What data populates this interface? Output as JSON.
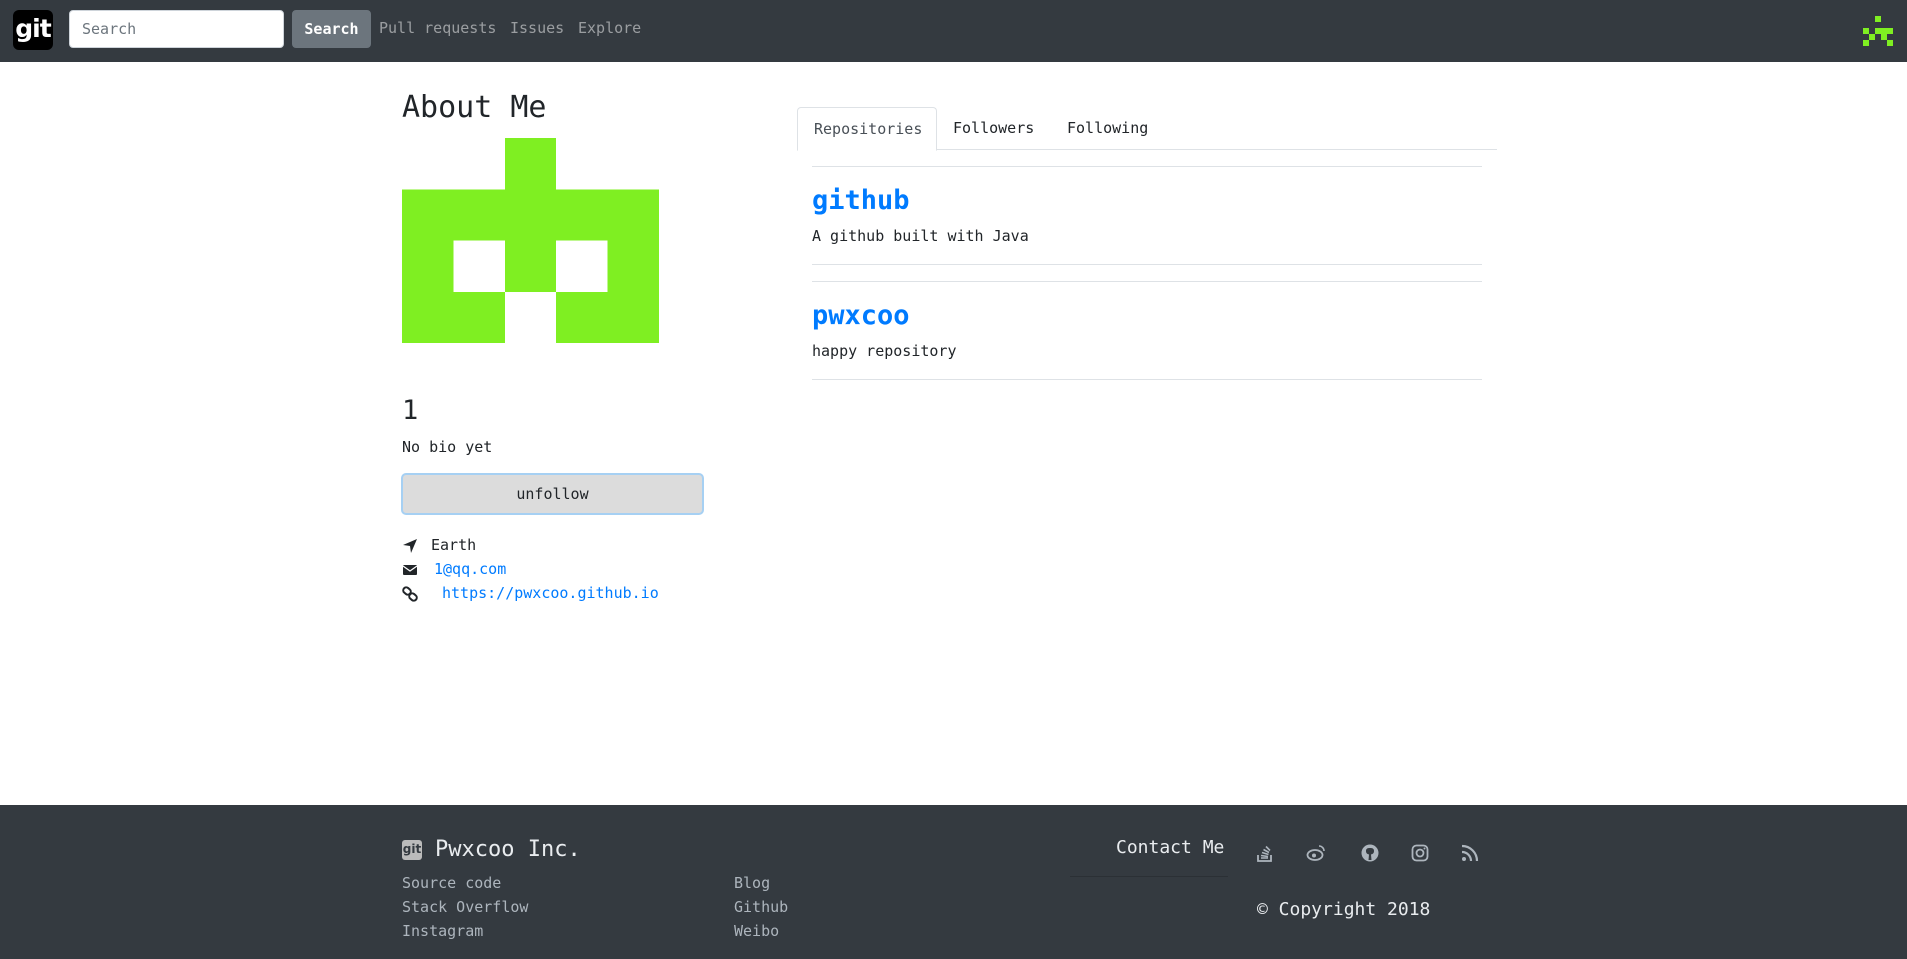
{
  "navbar": {
    "logo_text": "git",
    "search_placeholder": "Search",
    "search_button": "Search",
    "links": [
      "Pull requests",
      "Issues",
      "Explore"
    ]
  },
  "sidebar": {
    "title": "About Me",
    "avatar_color": "#7fef22",
    "username": "1",
    "bio": "No bio yet",
    "unfollow_label": "unfollow",
    "location": "Earth",
    "email": "1@qq.com",
    "website": "https://pwxcoo.github.io"
  },
  "tabs": [
    "Repositories",
    "Followers",
    "Following"
  ],
  "repositories": [
    {
      "name": "github",
      "description": "A github built with Java"
    },
    {
      "name": "pwxcoo",
      "description": "happy repository"
    }
  ],
  "footer": {
    "logo_text": "git",
    "company": "Pwxcoo Inc.",
    "links_col1": [
      "Source code",
      "Stack Overflow",
      "Instagram"
    ],
    "links_col2": [
      "Blog",
      "Github",
      "Weibo"
    ],
    "contact_title": "Contact Me",
    "social_icons": [
      "stackoverflow-icon",
      "weibo-icon",
      "github-icon",
      "instagram-icon",
      "rss-icon"
    ],
    "copyright": "© Copyright 2018"
  },
  "colors": {
    "navbar_bg": "#343a40",
    "link": "#007bff",
    "accent_green": "#7fef22"
  }
}
